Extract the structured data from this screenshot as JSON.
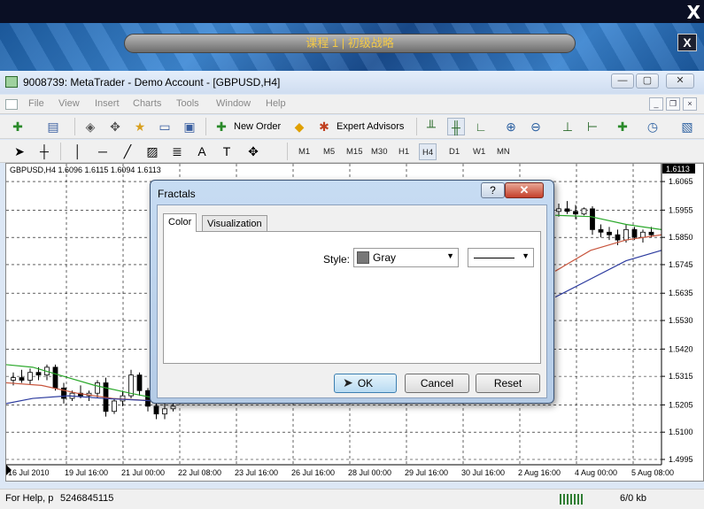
{
  "overlay": {
    "close_glyph": "X",
    "title": "课程 1 | 初级战略",
    "close_btn": "X"
  },
  "window": {
    "title": "9008739: MetaTrader - Demo Account - [GBPUSD,H4]",
    "min": "—",
    "max": "▢",
    "close": "✕"
  },
  "menu": [
    "File",
    "View",
    "Insert",
    "Charts",
    "Tools",
    "Window",
    "Help"
  ],
  "toolbar": {
    "new_order": "New Order",
    "expert_advisors": "Expert Advisors"
  },
  "timeframes": [
    "M1",
    "M5",
    "M15",
    "M30",
    "H1",
    "H4",
    "D1",
    "W1",
    "MN"
  ],
  "selected_timeframe": "H4",
  "chart": {
    "symbol_label": "GBPUSD,H4  1.6096 1.6115 1.6094 1.6113",
    "price_badge": "1.6113",
    "price_ticks": [
      "1.6065",
      "1.5955",
      "1.5850",
      "1.5745",
      "1.5635",
      "1.5530",
      "1.5420",
      "1.5315",
      "1.5205",
      "1.5100",
      "1.4995"
    ],
    "time_ticks": [
      "16 Jul 2010",
      "19 Jul 16:00",
      "21 Jul 00:00",
      "22 Jul 08:00",
      "23 Jul 16:00",
      "26 Jul 16:00",
      "28 Jul 00:00",
      "29 Jul 16:00",
      "30 Jul 16:00",
      "2 Aug 16:00",
      "4 Aug 00:00",
      "5 Aug 08:00"
    ]
  },
  "chart_data": {
    "type": "candlestick",
    "symbol": "GBPUSD",
    "timeframe": "H4",
    "last_price": 1.6113,
    "ylim": [
      1.4995,
      1.6113
    ],
    "left_candles": [
      {
        "o": 1.53,
        "h": 1.533,
        "l": 1.528,
        "c": 1.531
      },
      {
        "o": 1.531,
        "h": 1.534,
        "l": 1.529,
        "c": 1.53
      },
      {
        "o": 1.53,
        "h": 1.5345,
        "l": 1.5285,
        "c": 1.533
      },
      {
        "o": 1.533,
        "h": 1.535,
        "l": 1.53,
        "c": 1.532
      },
      {
        "o": 1.532,
        "h": 1.536,
        "l": 1.53,
        "c": 1.535
      },
      {
        "o": 1.535,
        "h": 1.536,
        "l": 1.526,
        "c": 1.527
      },
      {
        "o": 1.527,
        "h": 1.529,
        "l": 1.521,
        "c": 1.523
      },
      {
        "o": 1.523,
        "h": 1.526,
        "l": 1.522,
        "c": 1.525
      },
      {
        "o": 1.525,
        "h": 1.528,
        "l": 1.523,
        "c": 1.524
      },
      {
        "o": 1.524,
        "h": 1.526,
        "l": 1.522,
        "c": 1.525
      },
      {
        "o": 1.525,
        "h": 1.53,
        "l": 1.523,
        "c": 1.529
      },
      {
        "o": 1.529,
        "h": 1.531,
        "l": 1.516,
        "c": 1.518
      },
      {
        "o": 1.518,
        "h": 1.523,
        "l": 1.517,
        "c": 1.522
      },
      {
        "o": 1.522,
        "h": 1.526,
        "l": 1.52,
        "c": 1.524
      },
      {
        "o": 1.524,
        "h": 1.534,
        "l": 1.523,
        "c": 1.532
      },
      {
        "o": 1.532,
        "h": 1.533,
        "l": 1.524,
        "c": 1.526
      },
      {
        "o": 1.526,
        "h": 1.527,
        "l": 1.518,
        "c": 1.52
      },
      {
        "o": 1.52,
        "h": 1.525,
        "l": 1.515,
        "c": 1.517
      },
      {
        "o": 1.517,
        "h": 1.521,
        "l": 1.515,
        "c": 1.519
      },
      {
        "o": 1.519,
        "h": 1.523,
        "l": 1.518,
        "c": 1.52
      }
    ],
    "right_candles": [
      {
        "o": 1.595,
        "h": 1.598,
        "l": 1.593,
        "c": 1.596
      },
      {
        "o": 1.596,
        "h": 1.599,
        "l": 1.594,
        "c": 1.595
      },
      {
        "o": 1.595,
        "h": 1.5975,
        "l": 1.592,
        "c": 1.594
      },
      {
        "o": 1.594,
        "h": 1.5965,
        "l": 1.5935,
        "c": 1.596
      },
      {
        "o": 1.596,
        "h": 1.597,
        "l": 1.586,
        "c": 1.588
      },
      {
        "o": 1.588,
        "h": 1.59,
        "l": 1.585,
        "c": 1.587
      },
      {
        "o": 1.587,
        "h": 1.589,
        "l": 1.584,
        "c": 1.586
      },
      {
        "o": 1.586,
        "h": 1.588,
        "l": 1.582,
        "c": 1.584
      },
      {
        "o": 1.584,
        "h": 1.59,
        "l": 1.583,
        "c": 1.588
      },
      {
        "o": 1.588,
        "h": 1.589,
        "l": 1.584,
        "c": 1.585
      },
      {
        "o": 1.585,
        "h": 1.588,
        "l": 1.583,
        "c": 1.587
      },
      {
        "o": 1.587,
        "h": 1.589,
        "l": 1.585,
        "c": 1.586
      }
    ],
    "ma_colors": {
      "fast": "#2aa82a",
      "mid": "#c8553d",
      "slow": "#2b3a9e"
    }
  },
  "dialog": {
    "title": "Fractals",
    "help": "?",
    "close": "✕",
    "tabs": [
      "Color",
      "Visualization"
    ],
    "style_label": "Style:",
    "color_value": "Gray",
    "color_hex": "#777777",
    "ok": "OK",
    "cancel": "Cancel",
    "reset": "Reset"
  },
  "status": {
    "help_text": "For Help, p",
    "account": "5246845115",
    "traffic": "6/0 kb"
  }
}
